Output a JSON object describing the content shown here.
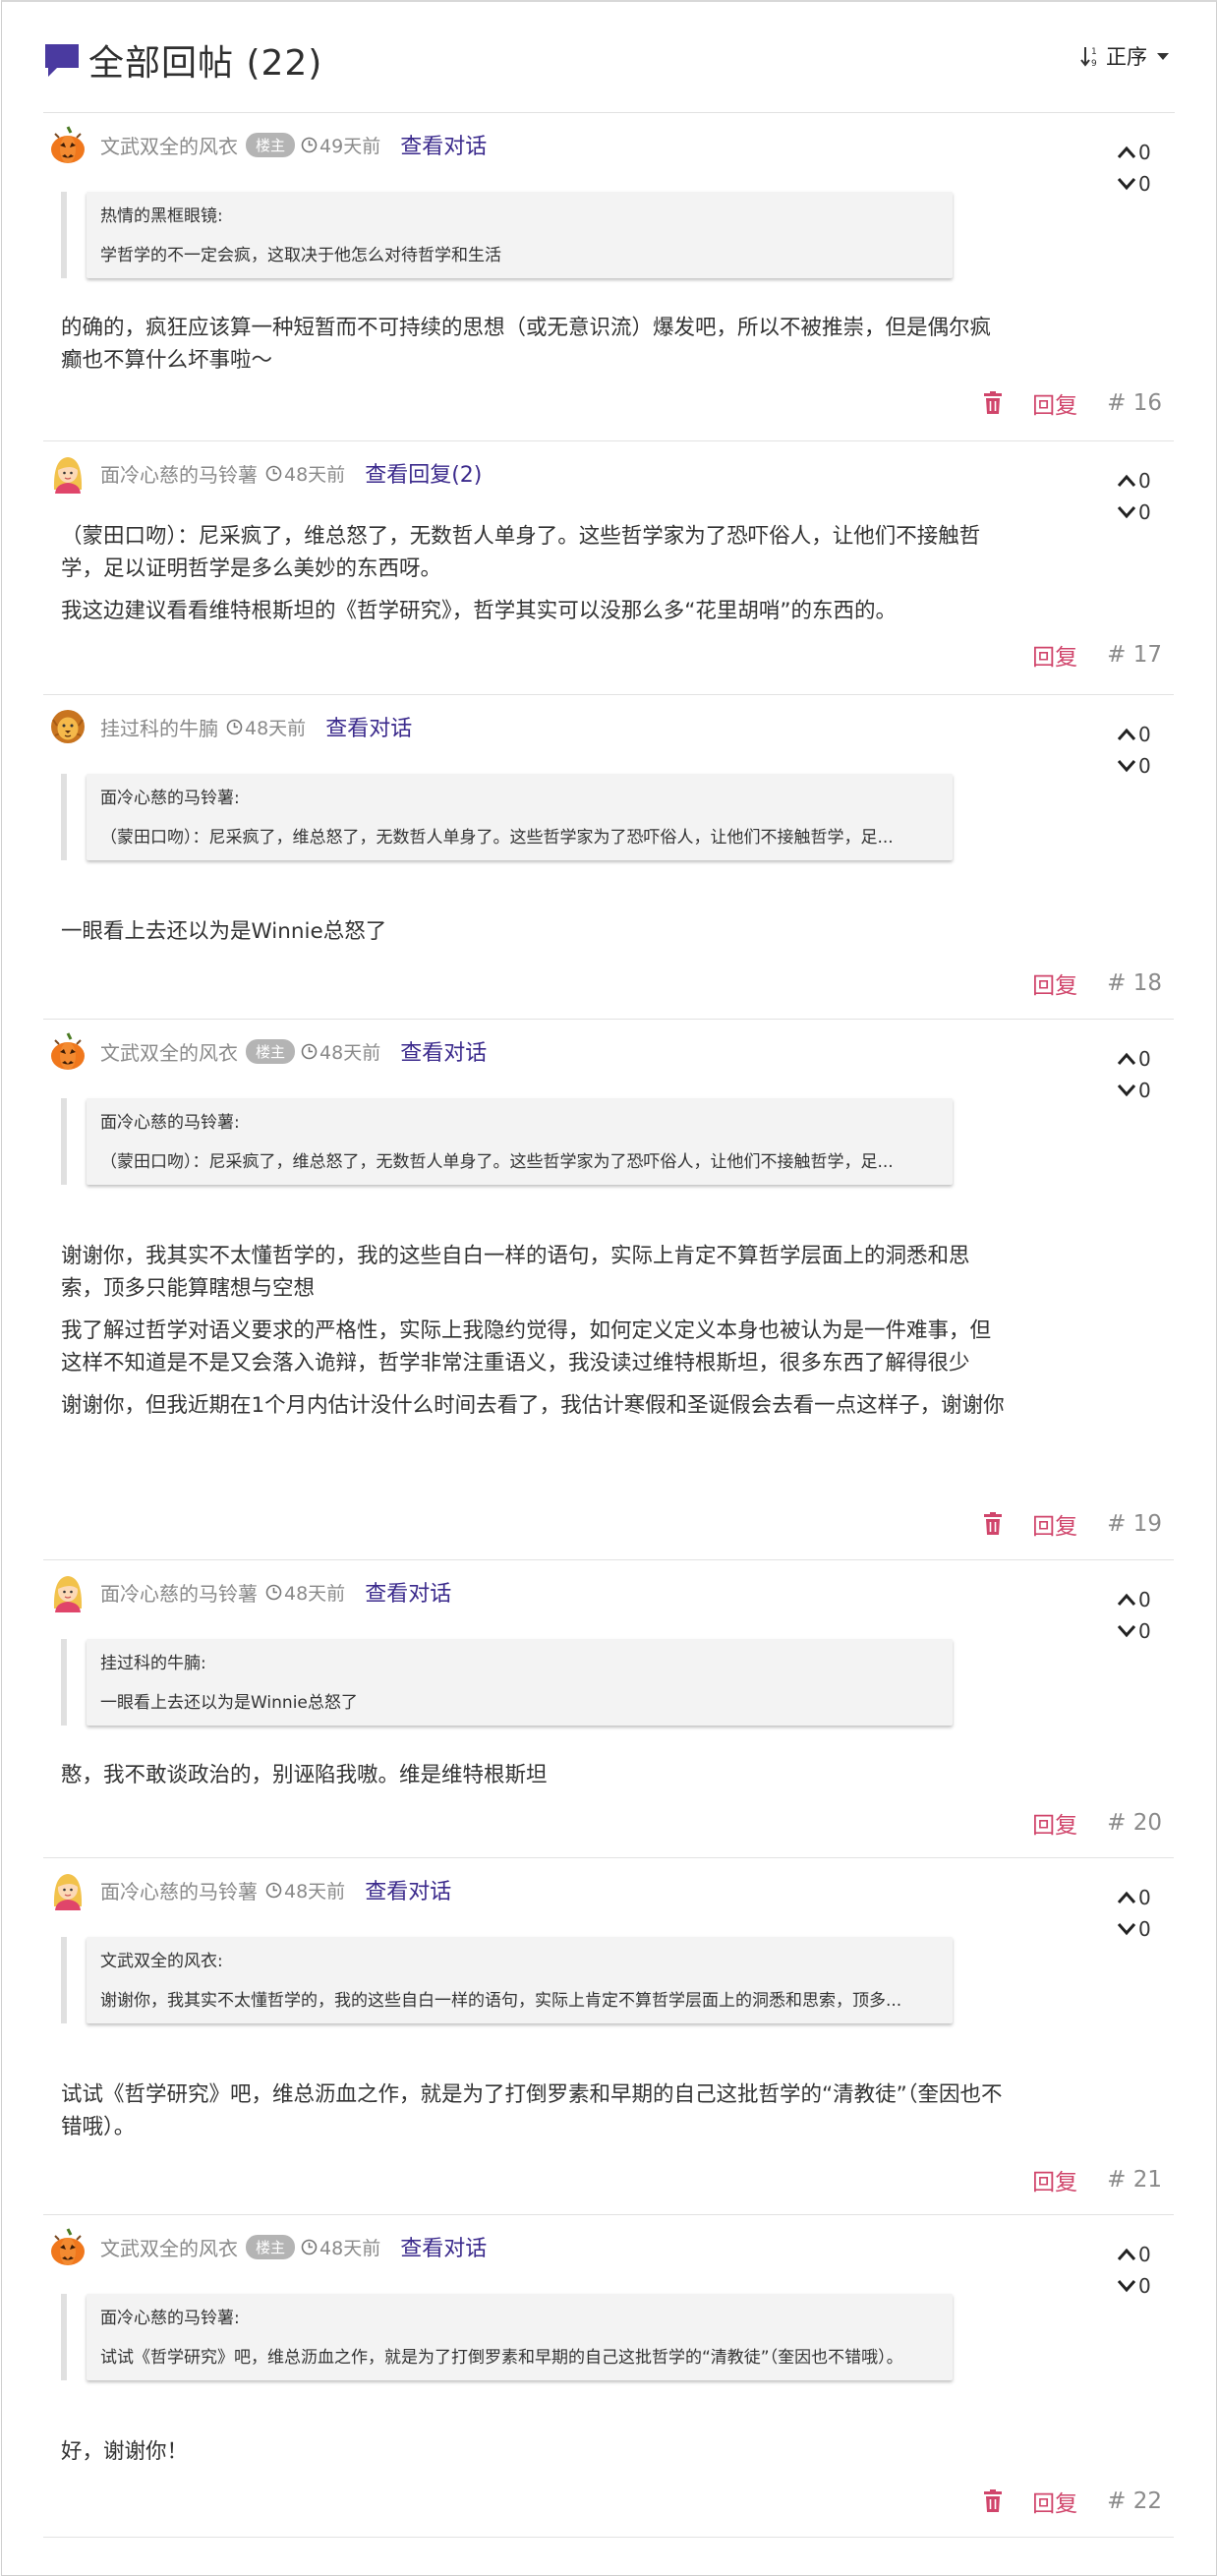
{
  "header": {
    "title": "全部回帖 (22)",
    "sort_label": "正序"
  },
  "posts": [
    {
      "user": "文武双全的风衣",
      "badge": "楼主",
      "time": "49天前",
      "link": "查看对话",
      "avatar": "pumpkin-avatar",
      "up": "0",
      "down": "0",
      "quote": {
        "name": "热情的黑框眼镜:",
        "text": "学哲学的不一定会疯，这取决于他怎么对待哲学和生活"
      },
      "paragraphs": [
        "的确的，疯狂应该算一种短暂而不可持续的思想（或无意识流）爆发吧，所以不被推崇，但是偶尔疯癫也不算什么坏事啦～"
      ],
      "reply": "回复",
      "floor": "# 16",
      "deletable": true
    },
    {
      "user": "面冷心慈的马铃薯",
      "badge": "",
      "time": "48天前",
      "link": "查看回复(2)",
      "avatar": "girl-avatar",
      "up": "0",
      "down": "0",
      "quote": null,
      "paragraphs": [
        "（蒙田口吻）：尼采疯了，维总怒了，无数哲人单身了。这些哲学家为了恐吓俗人，让他们不接触哲学，足以证明哲学是多么美妙的东西呀。",
        "我这边建议看看维特根斯坦的《哲学研究》，哲学其实可以没那么多“花里胡哨”的东西的。"
      ],
      "reply": "回复",
      "floor": "# 17",
      "deletable": false
    },
    {
      "user": "挂过科的牛腩",
      "badge": "",
      "time": "48天前",
      "link": "查看对话",
      "avatar": "lion-avatar",
      "up": "0",
      "down": "0",
      "quote": {
        "name": "面冷心慈的马铃薯:",
        "text": "（蒙田口吻）：尼采疯了，维总怒了，无数哲人单身了。这些哲学家为了恐吓俗人，让他们不接触哲学，足..."
      },
      "paragraphs": [
        "一眼看上去还以为是Winnie总怒了"
      ],
      "reply": "回复",
      "floor": "# 18",
      "deletable": false
    },
    {
      "user": "文武双全的风衣",
      "badge": "楼主",
      "time": "48天前",
      "link": "查看对话",
      "avatar": "pumpkin-avatar",
      "up": "0",
      "down": "0",
      "quote": {
        "name": "面冷心慈的马铃薯:",
        "text": "（蒙田口吻）：尼采疯了，维总怒了，无数哲人单身了。这些哲学家为了恐吓俗人，让他们不接触哲学，足..."
      },
      "paragraphs": [
        "谢谢你，我其实不太懂哲学的，我的这些自白一样的语句，实际上肯定不算哲学层面上的洞悉和思索，顶多只能算瞎想与空想",
        "我了解过哲学对语义要求的严格性，实际上我隐约觉得，如何定义定义本身也被认为是一件难事，但这样不知道是不是又会落入诡辩，哲学非常注重语义，我没读过维特根斯坦，很多东西了解得很少",
        "谢谢你，但我近期在1个月内估计没什么时间去看了，我估计寒假和圣诞假会去看一点这样子，谢谢你"
      ],
      "reply": "回复",
      "floor": "# 19",
      "deletable": true
    },
    {
      "user": "面冷心慈的马铃薯",
      "badge": "",
      "time": "48天前",
      "link": "查看对话",
      "avatar": "girl-avatar",
      "up": "0",
      "down": "0",
      "quote": {
        "name": "挂过科的牛腩:",
        "text": "一眼看上去还以为是Winnie总怒了"
      },
      "paragraphs": [
        "憨，我不敢谈政治的，别诬陷我嗷。维是维特根斯坦"
      ],
      "reply": "回复",
      "floor": "# 20",
      "deletable": false
    },
    {
      "user": "面冷心慈的马铃薯",
      "badge": "",
      "time": "48天前",
      "link": "查看对话",
      "avatar": "girl-avatar",
      "up": "0",
      "down": "0",
      "quote": {
        "name": "文武双全的风衣:",
        "text": "谢谢你，我其实不太懂哲学的，我的这些自白一样的语句，实际上肯定不算哲学层面上的洞悉和思索，顶多..."
      },
      "paragraphs": [
        "试试《哲学研究》吧，维总沥血之作，就是为了打倒罗素和早期的自己这批哲学的“清教徒”（奎因也不错哦）。"
      ],
      "reply": "回复",
      "floor": "# 21",
      "deletable": false
    },
    {
      "user": "文武双全的风衣",
      "badge": "楼主",
      "time": "48天前",
      "link": "查看对话",
      "avatar": "pumpkin-avatar",
      "up": "0",
      "down": "0",
      "quote": {
        "name": "面冷心慈的马铃薯:",
        "text": "试试《哲学研究》吧，维总沥血之作，就是为了打倒罗素和早期的自己这批哲学的“清教徒”（奎因也不错哦）。"
      },
      "paragraphs": [
        "好，谢谢你！"
      ],
      "reply": "回复",
      "floor": "# 22",
      "deletable": true
    }
  ]
}
